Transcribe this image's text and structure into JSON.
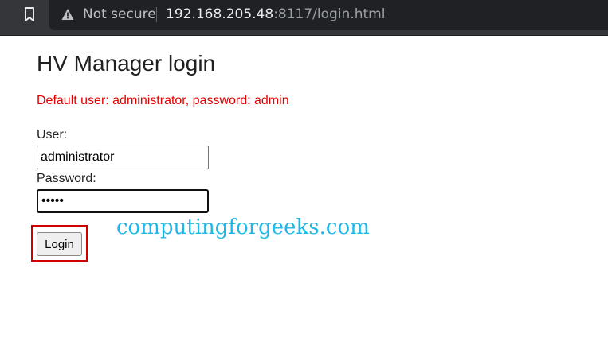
{
  "browser": {
    "security_label": "Not secure",
    "url_host": "192.168.205.48",
    "url_rest": ":8117/login.html"
  },
  "page": {
    "title": "HV Manager login",
    "hint": "Default user: administrator, password: admin",
    "user_label": "User:",
    "user_value": "administrator",
    "password_label": "Password:",
    "password_value": "admin",
    "login_label": "Login"
  },
  "watermark": "computingforgeeks.com",
  "colors": {
    "hint": "#e00000",
    "highlight": "#d00000",
    "watermark": "#1eb8e8",
    "toolbar": "#35363a"
  },
  "icons": [
    "bookmark-icon",
    "warning-icon"
  ]
}
